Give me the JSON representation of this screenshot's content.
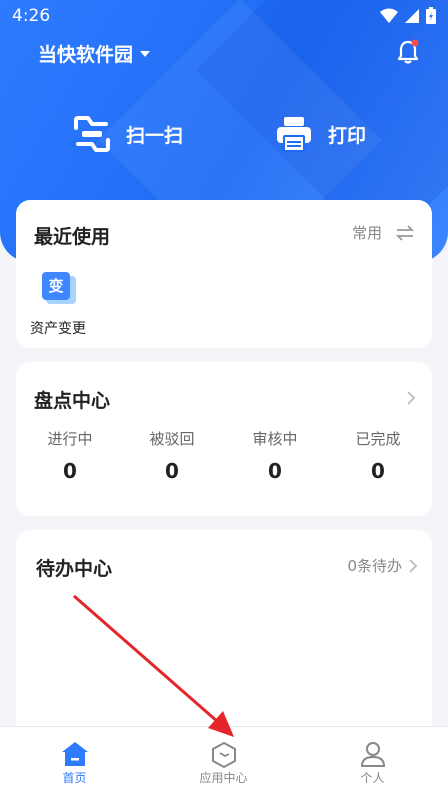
{
  "status_bar": {
    "time": "4:26"
  },
  "header": {
    "company": "当快软件园"
  },
  "quick_actions": {
    "scan": "扫一扫",
    "print": "打印"
  },
  "recent": {
    "title": "最近使用",
    "common_label": "常用",
    "items": [
      {
        "icon_text": "变",
        "label": "资产变更"
      }
    ]
  },
  "inventory": {
    "title": "盘点中心",
    "stats": [
      {
        "label": "进行中",
        "value": "0"
      },
      {
        "label": "被驳回",
        "value": "0"
      },
      {
        "label": "审核中",
        "value": "0"
      },
      {
        "label": "已完成",
        "value": "0"
      }
    ]
  },
  "todo": {
    "title": "待办中心",
    "count_text": "0条待办"
  },
  "tabbar": {
    "tabs": [
      {
        "label": "首页",
        "active": true
      },
      {
        "label": "应用中心",
        "active": false
      },
      {
        "label": "个人",
        "active": false
      }
    ]
  },
  "colors": {
    "primary": "#2f7bff",
    "annotation_arrow": "#e3262b",
    "badge": "#ff4d4f"
  }
}
